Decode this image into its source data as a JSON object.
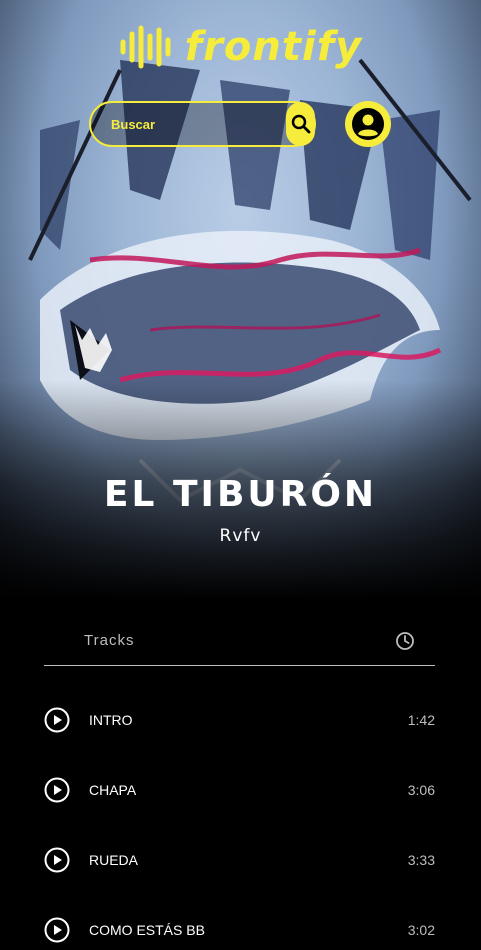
{
  "brand": {
    "name": "frontify",
    "color": "#f6ec3b"
  },
  "search": {
    "placeholder": "Buscar"
  },
  "album": {
    "title": "EL TIBURÓN",
    "artist": "Rvfv"
  },
  "tracks_section": {
    "label": "Tracks"
  },
  "tracks": [
    {
      "name": "INTRO",
      "duration": "1:42"
    },
    {
      "name": "CHAPA",
      "duration": "3:06"
    },
    {
      "name": "RUEDA",
      "duration": "3:33"
    },
    {
      "name": "COMO ESTÁS BB",
      "duration": "3:02"
    }
  ]
}
